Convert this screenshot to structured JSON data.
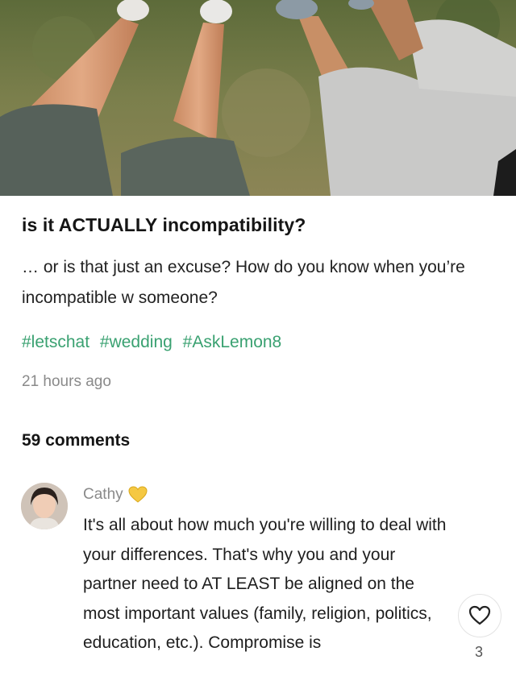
{
  "post": {
    "title": "is it ACTUALLY incompatibility?",
    "body": "… or is that just an excuse? How do you know when you’re incompatible w someone?",
    "tags": [
      "#letschat",
      "#wedding",
      "#AskLemon8"
    ],
    "timestamp": "21 hours ago"
  },
  "comments_section": {
    "count_label": "59 comments",
    "comments": [
      {
        "author": "Cathy",
        "author_badge_icon": "yellow-heart-icon",
        "text": "It's all about how much you're willing to deal with your differences. That's why you and your partner need to AT LEAST be aligned on the most important values (family, religion, politics, education, etc.). Compromise is",
        "likes": "3"
      }
    ]
  },
  "colors": {
    "tag_green": "#3aa171",
    "muted_gray": "#8a8a8a",
    "badge_yellow": "#f5c842"
  }
}
